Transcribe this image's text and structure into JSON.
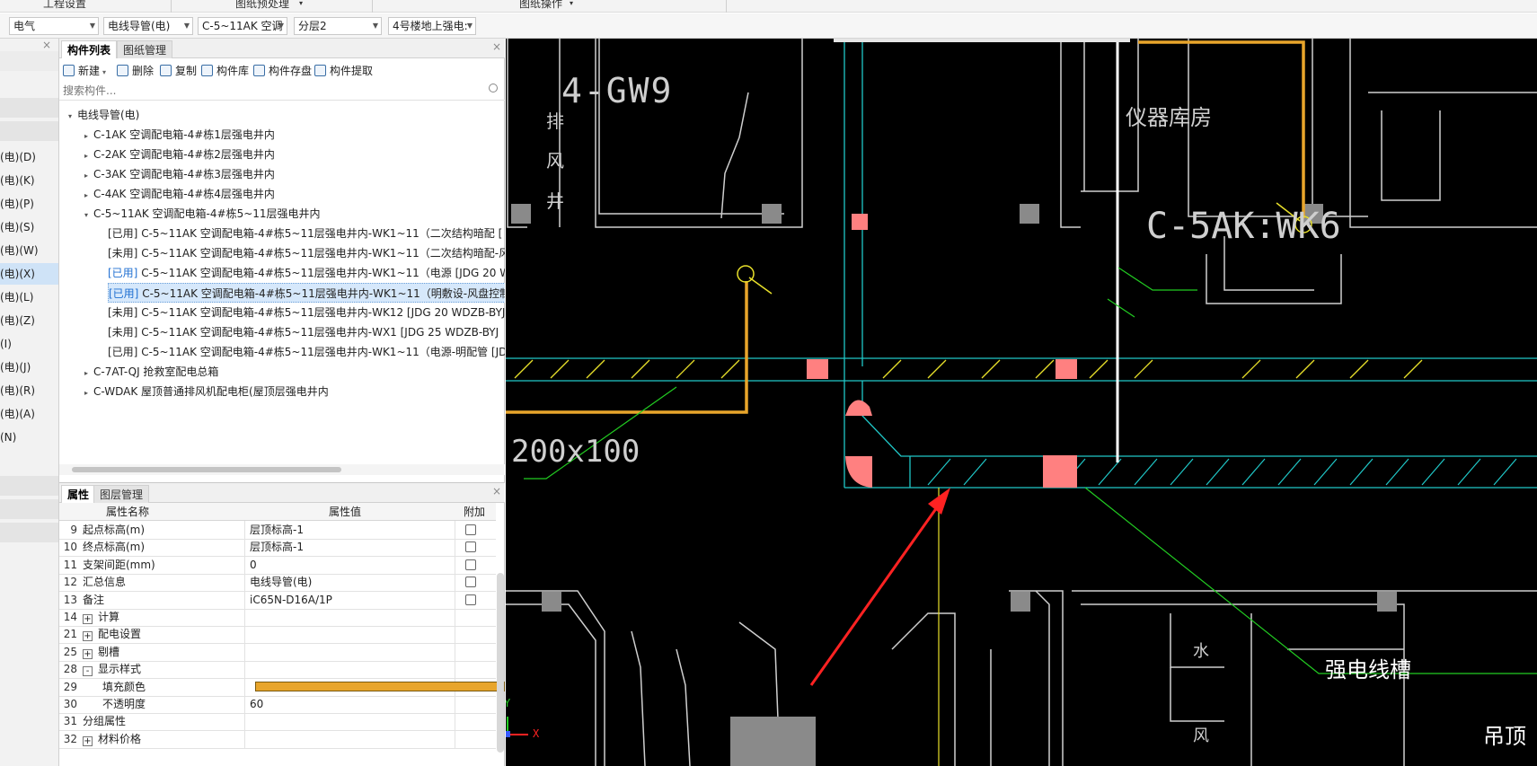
{
  "ribbon": {
    "groups": [
      "工程设置",
      "图纸预处理",
      "图纸操作"
    ]
  },
  "selectors": [
    {
      "value": "电气"
    },
    {
      "value": "电线导管(电)"
    },
    {
      "value": "C-5~11AK 空调"
    },
    {
      "value": "分层2"
    },
    {
      "value": "4号楼地上强电:"
    }
  ],
  "left_panel": {
    "items": [
      "(电)(D)",
      "(电)(K)",
      "(电)(P)",
      "(电)(S)",
      "(电)(W)",
      "(电)(X)",
      "(电)(L)",
      "(电)(Z)",
      "(I)",
      "(电)(J)",
      "(电)(R)",
      "(电)(A)",
      "(N)"
    ],
    "selected_index": 5
  },
  "component_panel": {
    "tabs": [
      "构件列表",
      "图纸管理"
    ],
    "toolbar": {
      "new": "新建",
      "delete": "删除",
      "copy": "复制",
      "library": "构件库",
      "save": "构件存盘",
      "extract": "构件提取"
    },
    "search_placeholder": "搜索构件...",
    "tree": {
      "root": "电线导管(电)",
      "groups": [
        "C-1AK 空调配电箱-4#栋1层强电井内",
        "C-2AK 空调配电箱-4#栋2层强电井内",
        "C-3AK 空调配电箱-4#栋3层强电井内",
        "C-4AK 空调配电箱-4#栋4层强电井内",
        "C-5~11AK 空调配电箱-4#栋5~11层强电井内"
      ],
      "children": [
        {
          "tag": "[已用]",
          "text": "C-5~11AK 空调配电箱-4#栋5~11层强电井内-WK1~11（二次结构暗配 [",
          "blue": false
        },
        {
          "tag": "[未用]",
          "text": "C-5~11AK 空调配电箱-4#栋5~11层强电井内-WK1~11（二次结构暗配-风",
          "blue": false
        },
        {
          "tag": "[已用]",
          "text": "C-5~11AK 空调配电箱-4#栋5~11层强电井内-WK1~11（电源 [JDG 20 W",
          "blue": true
        },
        {
          "tag": "[已用]",
          "text": "C-5~11AK 空调配电箱-4#栋5~11层强电井内-WK1~11（明敷设-风盘控制",
          "blue": true
        },
        {
          "tag": "[未用]",
          "text": "C-5~11AK 空调配电箱-4#栋5~11层强电井内-WK12 [JDG 20 WDZB-BYJ",
          "blue": false
        },
        {
          "tag": "[未用]",
          "text": "C-5~11AK 空调配电箱-4#栋5~11层强电井内-WX1 [JDG 25 WDZB-BYJ",
          "blue": false
        },
        {
          "tag": "[已用]",
          "text": "C-5~11AK 空调配电箱-4#栋5~11层强电井内-WK1~11（电源-明配管 [JD",
          "blue": false
        }
      ],
      "after": [
        "C-7AT-QJ 抢救室配电总箱",
        "C-WDAK 屋顶普通排风机配电柜(屋顶层强电井内"
      ]
    }
  },
  "properties_panel": {
    "tabs": [
      "属性",
      "图层管理"
    ],
    "headers": {
      "name": "属性名称",
      "value": "属性值",
      "extra": "附加"
    },
    "rows": [
      {
        "num": "9",
        "name": "起点标高(m)",
        "value": "层顶标高-1",
        "check": true,
        "expand": ""
      },
      {
        "num": "10",
        "name": "终点标高(m)",
        "value": "层顶标高-1",
        "check": true,
        "expand": ""
      },
      {
        "num": "11",
        "name": "支架间距(mm)",
        "value": "0",
        "check": true,
        "expand": ""
      },
      {
        "num": "12",
        "name": "汇总信息",
        "value": "电线导管(电)",
        "check": true,
        "expand": ""
      },
      {
        "num": "13",
        "name": "备注",
        "value": "iC65N-D16A/1P",
        "check": true,
        "expand": ""
      },
      {
        "num": "14",
        "name": "计算",
        "value": "",
        "check": false,
        "expand": "+"
      },
      {
        "num": "21",
        "name": "配电设置",
        "value": "",
        "check": false,
        "expand": "+"
      },
      {
        "num": "25",
        "name": "剔槽",
        "value": "",
        "check": false,
        "expand": "+"
      },
      {
        "num": "28",
        "name": "显示样式",
        "value": "",
        "check": false,
        "expand": "-"
      },
      {
        "num": "29",
        "name": "填充颜色",
        "value": "",
        "check": false,
        "expand": "",
        "indent": true,
        "color": "#e8a52b"
      },
      {
        "num": "30",
        "name": "不透明度",
        "value": "60",
        "check": false,
        "expand": "",
        "indent": true
      },
      {
        "num": "31",
        "name": "分组属性",
        "value": "",
        "check": false,
        "expand": ""
      },
      {
        "num": "32",
        "name": "材料价格",
        "value": "",
        "check": false,
        "expand": "+"
      }
    ]
  },
  "cad": {
    "labels": {
      "room_gw": "4-GW9",
      "room_storage": "仪器库房",
      "circuit": "C-5AK:WK6",
      "duct_size": "200x100",
      "trunking": "强电线槽",
      "ceiling": "吊顶",
      "shaft_side": [
        "排",
        "风",
        "井"
      ],
      "water": "水",
      "wind": "风",
      "axis_x": "X",
      "axis_y": "Y"
    },
    "colors": {
      "background": "#000000",
      "conduit": "#e8a52b",
      "wall": "#cfcfcf",
      "cyan": "#20c8c8",
      "green_leader": "#22cc22",
      "arrow": "#ff2222",
      "hatch": "#e8e02a",
      "column": "#ff8080"
    }
  }
}
